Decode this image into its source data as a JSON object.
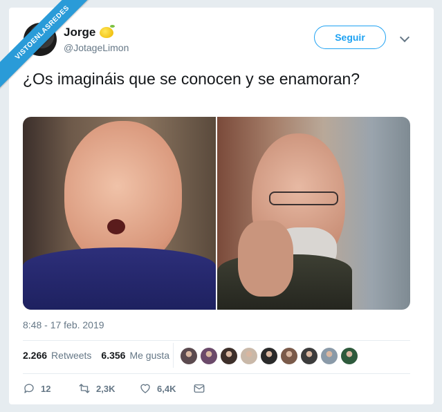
{
  "watermark": {
    "text": "VISTOENLASREDES"
  },
  "tweet": {
    "author": {
      "name": "Jorge",
      "handle": "@JotageLimon",
      "emoji_icon": "lemon-icon"
    },
    "follow_label": "Seguir",
    "text": "¿Os imagináis que se conocen y se enamoran?",
    "timestamp": "8:48 - 17 feb. 2019",
    "retweets_count": "2.266",
    "retweets_label": "Retweets",
    "likes_count": "6.356",
    "likes_label": "Me gusta",
    "liker_colors": [
      "#5b4a4f",
      "#6b4a6a",
      "#3d2f2a",
      "#c9b8a8",
      "#2a2a2a",
      "#7a5a4a",
      "#3c3c3c",
      "#8a9aa8",
      "#2e5a3c"
    ],
    "actions": {
      "replies": "12",
      "retweets": "2,3K",
      "likes": "6,4K"
    }
  },
  "colors": {
    "accent": "#1da1f2",
    "ribbon": "#2a9bd8",
    "muted": "#657786",
    "text": "#14171a"
  }
}
